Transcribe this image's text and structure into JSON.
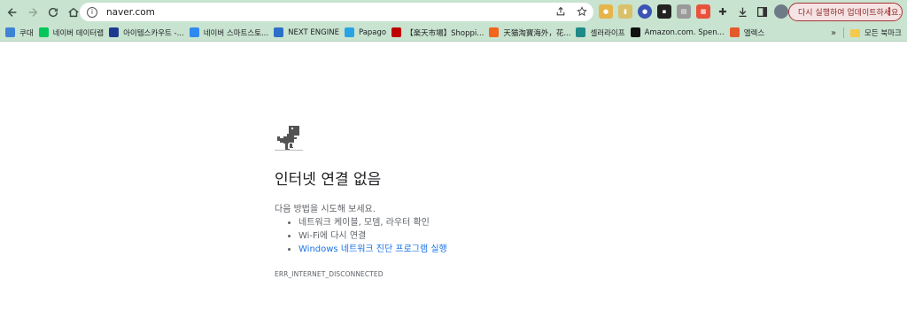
{
  "toolbar": {
    "url": "naver.com",
    "update_label": "다시 실행하여 업데이트하세요.",
    "icons": [
      "back-icon",
      "forward-icon",
      "reload-icon",
      "home-icon",
      "site-info-icon",
      "share-icon",
      "star-icon",
      "puzzle-icon",
      "download-icon",
      "side-panel-icon",
      "profile-avatar",
      "kebab-menu-icon"
    ]
  },
  "bookmarks": [
    {
      "label": "쿠대",
      "color": "#3f83d6"
    },
    {
      "label": "네이버 데이터랩",
      "color": "#03c75a"
    },
    {
      "label": "아이템스카우트 -...",
      "color": "#1b3a8f"
    },
    {
      "label": "네이버 스마트스토...",
      "color": "#2f8af0"
    },
    {
      "label": "NEXT ENGINE",
      "color": "#2c6fc7"
    },
    {
      "label": "Papago",
      "color": "#29a3e6"
    },
    {
      "label": "【楽天市場】Shoppi...",
      "color": "#bf0000"
    },
    {
      "label": "天猫淘寶海外，花...",
      "color": "#f2651c"
    },
    {
      "label": "셀러라이프",
      "color": "#1f8a86"
    },
    {
      "label": "Amazon.com. Spen...",
      "color": "#111111"
    },
    {
      "label": "엘렉스",
      "color": "#e55a2b"
    }
  ],
  "bookmarks_more": "»",
  "all_bookmarks": "모든 북마크",
  "error_page": {
    "title": "인터넷 연결 없음",
    "suggest_head": "다음 방법을 시도해 보세요.",
    "suggestions": [
      "네트워크 케이블, 모뎀, 라우터 확인",
      "Wi-Fi에 다시 연결",
      "Windows 네트워크 진단 프로그램 실행"
    ],
    "error_code": "ERR_INTERNET_DISCONNECTED"
  }
}
